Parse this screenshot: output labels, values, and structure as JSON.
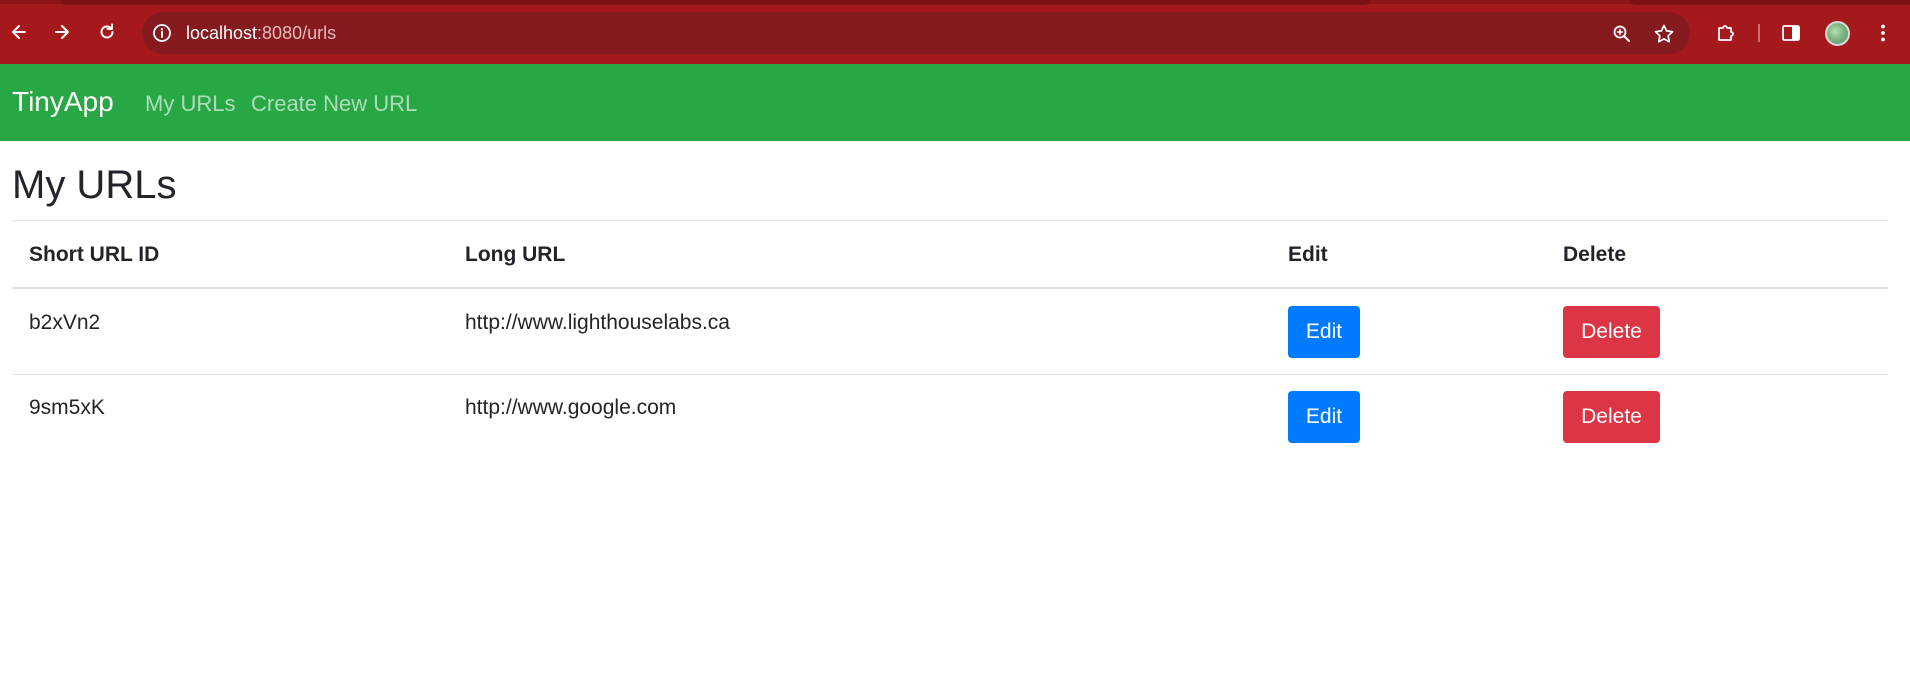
{
  "browser": {
    "url_host": "localhost",
    "url_rest": ":8080/urls"
  },
  "navbar": {
    "brand": "TinyApp",
    "links": [
      "My URLs",
      "Create New URL"
    ]
  },
  "page": {
    "title": "My URLs"
  },
  "table": {
    "headers": [
      "Short URL ID",
      "Long URL",
      "Edit",
      "Delete"
    ],
    "rows": [
      {
        "short_id": "b2xVn2",
        "long_url": "http://www.lighthouselabs.ca",
        "edit_label": "Edit",
        "delete_label": "Delete"
      },
      {
        "short_id": "9sm5xK",
        "long_url": "http://www.google.com",
        "edit_label": "Edit",
        "delete_label": "Delete"
      }
    ]
  },
  "colors": {
    "chrome": "#a5191c",
    "navbar": "#28a745",
    "edit_button": "#007bff",
    "delete_button": "#dc3545"
  }
}
